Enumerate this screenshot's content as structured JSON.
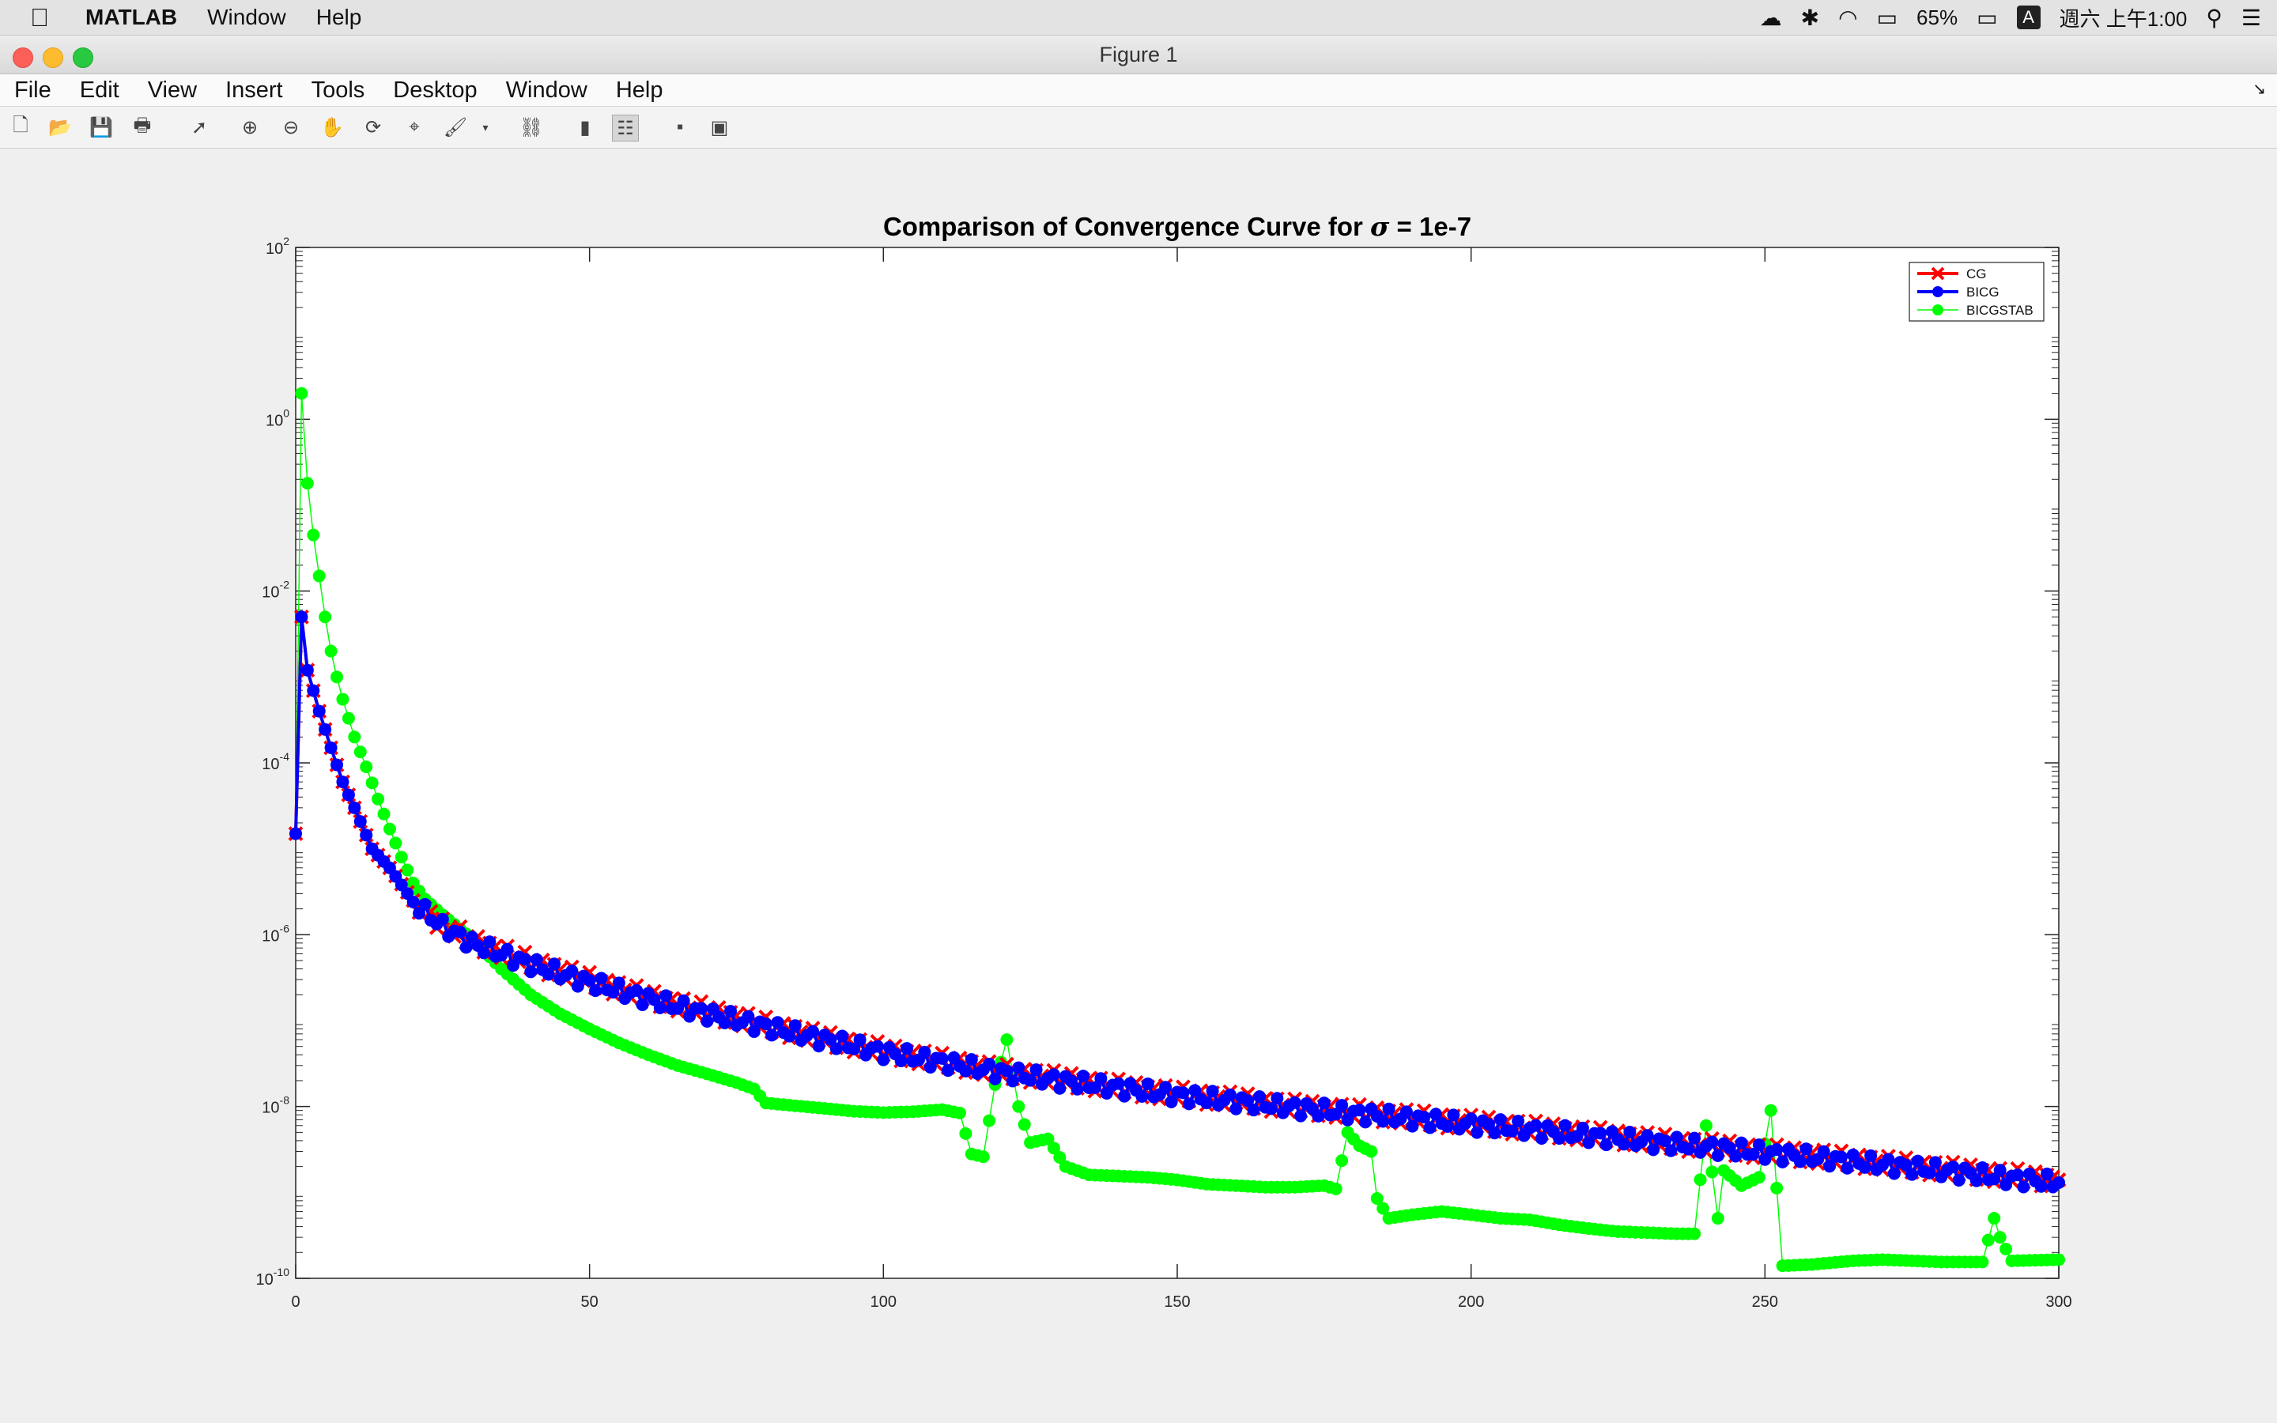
{
  "menubar": {
    "apple_icon": "apple-icon",
    "items": [
      "MATLAB",
      "Window",
      "Help"
    ],
    "battery": "65%",
    "input_method": "A",
    "clock": "週六 上午1:00"
  },
  "window": {
    "title": "Figure 1"
  },
  "app_menu": [
    "File",
    "Edit",
    "View",
    "Insert",
    "Tools",
    "Desktop",
    "Window",
    "Help"
  ],
  "toolbar_icons": [
    "new-figure-icon",
    "open-file-icon",
    "save-icon",
    "print-icon",
    "edit-plot-icon",
    "zoom-in-icon",
    "zoom-out-icon",
    "pan-icon",
    "rotate-3d-icon",
    "data-cursor-icon",
    "brush-icon",
    "brush-menu-icon",
    "link-plot-icon",
    "colorbar-icon",
    "legend-icon",
    "hide-plot-tools-icon",
    "show-plot-tools-icon"
  ],
  "chart_data": {
    "type": "line",
    "title": "Comparison of Convergence Curve for σ = 1e-7",
    "title_prefix": "Comparison of Convergence Curve for ",
    "title_sigma": "σ",
    "title_suffix": " = 1e-7",
    "xlabel": "",
    "ylabel": "",
    "xlim": [
      0,
      300
    ],
    "ylim": [
      1e-10,
      100
    ],
    "yscale": "log",
    "xticks": [
      "0",
      "50",
      "100",
      "150",
      "200",
      "250",
      "300"
    ],
    "yticks": [
      {
        "base": "10",
        "exp": "-10"
      },
      {
        "base": "10",
        "exp": "-8"
      },
      {
        "base": "10",
        "exp": "-6"
      },
      {
        "base": "10",
        "exp": "-4"
      },
      {
        "base": "10",
        "exp": "-2"
      },
      {
        "base": "10",
        "exp": "0"
      },
      {
        "base": "10",
        "exp": "2"
      }
    ],
    "legend_position": "top-right",
    "grid": false,
    "series": [
      {
        "name": "CG",
        "color": "#ff0000",
        "marker": "x",
        "points": [
          [
            0,
            1.5e-05
          ],
          [
            1,
            0.005
          ],
          [
            2,
            0.0012
          ],
          [
            4,
            0.0004
          ],
          [
            6,
            0.00015
          ],
          [
            8,
            6e-05
          ],
          [
            10,
            3e-05
          ],
          [
            13,
            1e-05
          ],
          [
            16,
            6e-06
          ],
          [
            20,
            2.5e-06
          ],
          [
            25,
            1.3e-06
          ],
          [
            30,
            8.5e-07
          ],
          [
            35,
            6.5e-07
          ],
          [
            40,
            4.8e-07
          ],
          [
            50,
            3e-07
          ],
          [
            60,
            1.9e-07
          ],
          [
            70,
            1.3e-07
          ],
          [
            80,
            9e-08
          ],
          [
            90,
            6.2e-08
          ],
          [
            100,
            4.5e-08
          ],
          [
            110,
            3.4e-08
          ],
          [
            120,
            2.6e-08
          ],
          [
            130,
            2.1e-08
          ],
          [
            140,
            1.7e-08
          ],
          [
            150,
            1.4e-08
          ],
          [
            160,
            1.2e-08
          ],
          [
            170,
            1e-08
          ],
          [
            180,
            8.7e-09
          ],
          [
            190,
            7.5e-09
          ],
          [
            200,
            6.5e-09
          ],
          [
            210,
            5.6e-09
          ],
          [
            220,
            4.8e-09
          ],
          [
            230,
            4.1e-09
          ],
          [
            240,
            3.5e-09
          ],
          [
            250,
            3e-09
          ],
          [
            260,
            2.6e-09
          ],
          [
            270,
            2.2e-09
          ],
          [
            280,
            1.9e-09
          ],
          [
            290,
            1.6e-09
          ],
          [
            300,
            1.4e-09
          ]
        ]
      },
      {
        "name": "BICG",
        "color": "#0000ff",
        "marker": "o",
        "points": [
          [
            0,
            1.5e-05
          ],
          [
            1,
            0.005
          ],
          [
            2,
            0.0012
          ],
          [
            4,
            0.0004
          ],
          [
            6,
            0.00015
          ],
          [
            8,
            6e-05
          ],
          [
            10,
            3e-05
          ],
          [
            13,
            1e-05
          ],
          [
            16,
            6e-06
          ],
          [
            20,
            2.4e-06
          ],
          [
            25,
            1.25e-06
          ],
          [
            30,
            8e-07
          ],
          [
            35,
            6e-07
          ],
          [
            40,
            4.5e-07
          ],
          [
            50,
            2.8e-07
          ],
          [
            60,
            1.8e-07
          ],
          [
            70,
            1.2e-07
          ],
          [
            80,
            8.5e-08
          ],
          [
            90,
            6e-08
          ],
          [
            100,
            4.3e-08
          ],
          [
            110,
            3.3e-08
          ],
          [
            120,
            2.5e-08
          ],
          [
            130,
            2e-08
          ],
          [
            140,
            1.65e-08
          ],
          [
            150,
            1.35e-08
          ],
          [
            160,
            1.15e-08
          ],
          [
            170,
            9.7e-09
          ],
          [
            180,
            8.3e-09
          ],
          [
            190,
            7.2e-09
          ],
          [
            200,
            6.2e-09
          ],
          [
            210,
            5.4e-09
          ],
          [
            220,
            4.6e-09
          ],
          [
            230,
            3.9e-09
          ],
          [
            240,
            3.4e-09
          ],
          [
            250,
            2.9e-09
          ],
          [
            260,
            2.5e-09
          ],
          [
            270,
            2.1e-09
          ],
          [
            280,
            1.8e-09
          ],
          [
            290,
            1.5e-09
          ],
          [
            300,
            1.3e-09
          ]
        ]
      },
      {
        "name": "BICGSTAB",
        "color": "#00ff00",
        "marker": "o",
        "points": [
          [
            0,
            1.5e-05
          ],
          [
            1,
            2.0
          ],
          [
            2,
            0.18
          ],
          [
            3,
            0.045
          ],
          [
            4,
            0.015
          ],
          [
            5,
            0.005
          ],
          [
            6,
            0.002
          ],
          [
            7,
            0.001
          ],
          [
            8,
            0.00055
          ],
          [
            9,
            0.00033
          ],
          [
            10,
            0.0002
          ],
          [
            12,
            9e-05
          ],
          [
            14,
            3.8e-05
          ],
          [
            16,
            1.7e-05
          ],
          [
            18,
            8e-06
          ],
          [
            20,
            4e-06
          ],
          [
            22,
            2.6e-06
          ],
          [
            25,
            1.7e-06
          ],
          [
            30,
            9e-07
          ],
          [
            35,
            4e-07
          ],
          [
            40,
            2e-07
          ],
          [
            45,
            1.2e-07
          ],
          [
            50,
            8e-08
          ],
          [
            55,
            5.5e-08
          ],
          [
            60,
            4e-08
          ],
          [
            65,
            3e-08
          ],
          [
            70,
            2.4e-08
          ],
          [
            75,
            1.9e-08
          ],
          [
            78,
            1.6e-08
          ],
          [
            80,
            1.1e-08
          ],
          [
            85,
            1.02e-08
          ],
          [
            90,
            9.5e-09
          ],
          [
            95,
            8.8e-09
          ],
          [
            100,
            8.5e-09
          ],
          [
            105,
            8.7e-09
          ],
          [
            110,
            9.2e-09
          ],
          [
            113,
            8.4e-09
          ],
          [
            115,
            2.8e-09
          ],
          [
            117,
            2.6e-09
          ],
          [
            119,
            1.8e-08
          ],
          [
            121,
            6e-08
          ],
          [
            123,
            1e-08
          ],
          [
            125,
            3.8e-09
          ],
          [
            128,
            4.2e-09
          ],
          [
            131,
            2e-09
          ],
          [
            135,
            1.6e-09
          ],
          [
            140,
            1.55e-09
          ],
          [
            145,
            1.5e-09
          ],
          [
            150,
            1.4e-09
          ],
          [
            155,
            1.25e-09
          ],
          [
            160,
            1.2e-09
          ],
          [
            165,
            1.15e-09
          ],
          [
            170,
            1.15e-09
          ],
          [
            175,
            1.2e-09
          ],
          [
            177,
            1.1e-09
          ],
          [
            179,
            5e-09
          ],
          [
            181,
            3.5e-09
          ],
          [
            183,
            3e-09
          ],
          [
            184,
            8.5e-10
          ],
          [
            186,
            5e-10
          ],
          [
            190,
            5.5e-10
          ],
          [
            195,
            6e-10
          ],
          [
            200,
            5.5e-10
          ],
          [
            205,
            5e-10
          ],
          [
            210,
            4.8e-10
          ],
          [
            215,
            4.2e-10
          ],
          [
            220,
            3.8e-10
          ],
          [
            225,
            3.5e-10
          ],
          [
            230,
            3.4e-10
          ],
          [
            235,
            3.3e-10
          ],
          [
            238,
            3.3e-10
          ],
          [
            240,
            6e-09
          ],
          [
            242,
            5e-10
          ],
          [
            243,
            1.8e-09
          ],
          [
            246,
            1.2e-09
          ],
          [
            249,
            1.5e-09
          ],
          [
            251,
            9e-09
          ],
          [
            253,
            1.4e-10
          ],
          [
            258,
            1.45e-10
          ],
          [
            265,
            1.6e-10
          ],
          [
            270,
            1.65e-10
          ],
          [
            275,
            1.6e-10
          ],
          [
            280,
            1.55e-10
          ],
          [
            287,
            1.55e-10
          ],
          [
            289,
            5e-10
          ],
          [
            290,
            3e-10
          ],
          [
            292,
            1.6e-10
          ],
          [
            300,
            1.65e-10
          ]
        ]
      }
    ]
  }
}
